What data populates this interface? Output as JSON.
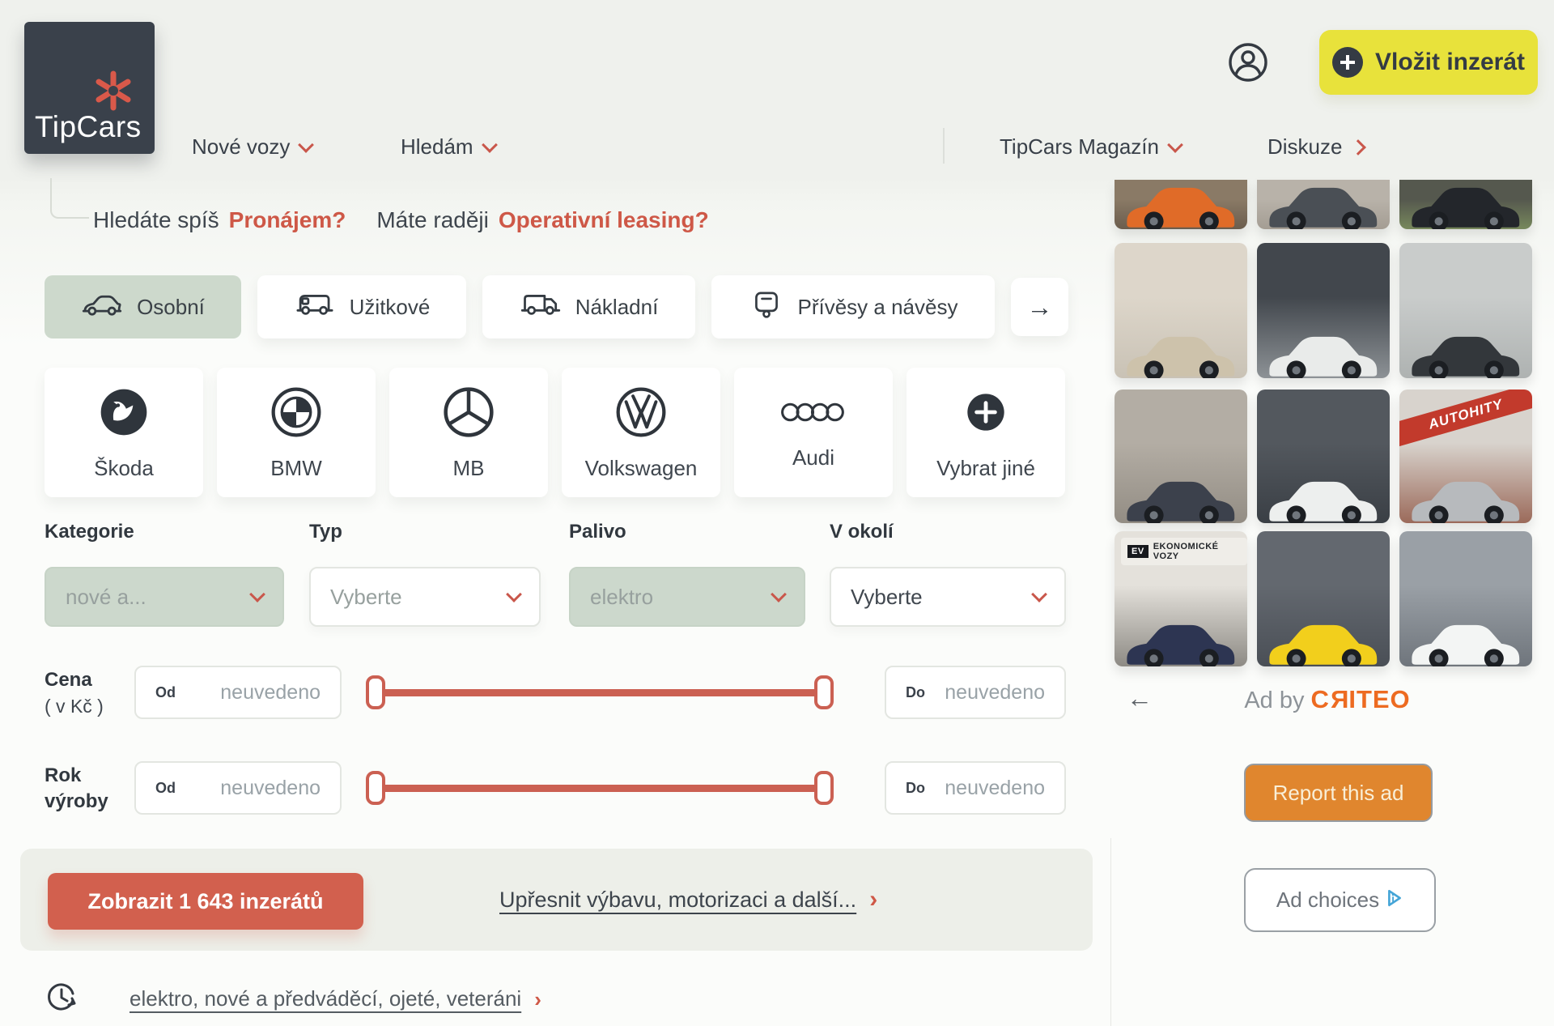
{
  "header": {
    "logo": {
      "text": "TipCars",
      "mark_icon": "asterisk-icon",
      "mark_color": "#d9594a"
    },
    "nav_left": [
      {
        "label": "Nové vozy",
        "chevron": "down"
      },
      {
        "label": "Hledám",
        "chevron": "down"
      }
    ],
    "nav_right": [
      {
        "label": "TipCars Magazín",
        "chevron": "down"
      },
      {
        "label": "Diskuze",
        "chevron": "right"
      }
    ],
    "account_icon": "user-icon",
    "post_button": {
      "label": "Vložit inzerát",
      "icon": "plus-icon"
    }
  },
  "promo": {
    "text1": "Hledáte spíš",
    "link1": "Pronájem?",
    "text2": "Máte raději",
    "link2": "Operativní leasing?"
  },
  "vehicle_types": {
    "items": [
      {
        "label": "Osobní",
        "icon": "car-icon",
        "selected": true
      },
      {
        "label": "Užitkové",
        "icon": "van-icon",
        "selected": false
      },
      {
        "label": "Nákladní",
        "icon": "truck-icon",
        "selected": false
      },
      {
        "label": "Přívěsy a návěsy",
        "icon": "trailer-icon",
        "selected": false
      }
    ],
    "more_arrow": "→"
  },
  "brands": {
    "items": [
      {
        "label": "Škoda",
        "icon": "skoda-logo"
      },
      {
        "label": "BMW",
        "icon": "bmw-logo"
      },
      {
        "label": "MB",
        "icon": "mercedes-logo"
      },
      {
        "label": "Volkswagen",
        "icon": "volkswagen-logo"
      },
      {
        "label": "Audi",
        "icon": "audi-logo"
      },
      {
        "label": "Vybrat jiné",
        "icon": "plus-circle-icon"
      }
    ]
  },
  "filters": {
    "items": [
      {
        "label": "Kategorie",
        "value": "nové a...",
        "filled": true,
        "muted": true
      },
      {
        "label": "Typ",
        "value": "Vyberte",
        "filled": false,
        "muted": true
      },
      {
        "label": "Palivo",
        "value": "elektro",
        "filled": true,
        "muted": true
      },
      {
        "label": "V okolí",
        "value": "Vyberte",
        "filled": false,
        "muted": false
      }
    ]
  },
  "ranges": {
    "items": [
      {
        "line1": "Cena",
        "line2": "( v Kč )",
        "line2_bold": false,
        "from_label": "Od",
        "from_value": "neuvedeno",
        "to_label": "Do",
        "to_value": "neuvedeno"
      },
      {
        "line1": "Rok",
        "line2": "výroby",
        "line2_bold": true,
        "from_label": "Od",
        "from_value": "neuvedeno",
        "to_label": "Do",
        "to_value": "neuvedeno"
      }
    ]
  },
  "results": {
    "submit_label": "Zobrazit 1 643 inzerátů",
    "refine_label": "Upřesnit výbavu, motorizaci a další...",
    "chevron": "›"
  },
  "history": {
    "icon": "history-icon",
    "link": "elektro, nové a předváděcí, ojeté, veteráni",
    "chevron": "›"
  },
  "ad": {
    "back_arrow": "←",
    "label": "Ad by",
    "brand": "CRITEO",
    "report_button": "Report this ad",
    "choices_button": "Ad choices",
    "choices_icon": "adchoices-icon",
    "tiles": [
      {
        "name": "orange-sports-car",
        "env_top": "#8a7a66",
        "env_bottom": "#6b5d4d",
        "body": "#e06b28"
      },
      {
        "name": "gray-suv-front",
        "env_top": "#b8b2a9",
        "env_bottom": "#a49d93",
        "body": "#4a4f55"
      },
      {
        "name": "white-roof-suv-grass",
        "env_top": "#55584e",
        "env_bottom": "#77885c",
        "body": "#23262b"
      },
      {
        "name": "volvo-xc90-studio",
        "env_top": "#ddd6ca",
        "env_bottom": "#c9c2b5",
        "body": "#cdc2ab"
      },
      {
        "name": "ford-bronco-dealership",
        "env_top": "#42474d",
        "env_bottom": "#8d9296",
        "body": "#e9ebea"
      },
      {
        "name": "defender-matte-black",
        "env_top": "#c9cccb",
        "env_bottom": "#aeb2b1",
        "body": "#33373b"
      },
      {
        "name": "rolls-royce-ghost",
        "env_top": "#b3ada4",
        "env_bottom": "#938d84",
        "body": "#3c414c"
      },
      {
        "name": "ford-gt-showroom",
        "env_top": "#53585e",
        "env_bottom": "#3a3f45",
        "body": "#edefee"
      },
      {
        "name": "skoda-kodiaq-autohity",
        "env_top": "#d8d3cd",
        "env_bottom": "#9b6a5a",
        "body": "#b7babd",
        "badge": "AUTOHITY",
        "badge_bg": "#c23a2c",
        "badge_fg": "#ffffff"
      },
      {
        "name": "maserati-levante-ev",
        "env_top": "#e4e1db",
        "env_bottom": "#8d8a84",
        "body": "#2d3552",
        "badge": "EKONOMICKÉ VOZY",
        "badge_tag": "EV",
        "badge_bg": "#efede8",
        "badge_fg": "#23262a"
      },
      {
        "name": "lamborghini-urus-yellow",
        "env_top": "#63686f",
        "env_bottom": "#4a4f56",
        "body": "#f2cf1c"
      },
      {
        "name": "bmw-3gt-white",
        "env_top": "#9aa0a6",
        "env_bottom": "#6f757c",
        "body": "#f3f5f4"
      }
    ]
  },
  "colors": {
    "accent_red": "#cd5a49",
    "sage_fill": "#ccd8cc",
    "header_bg": "#eff1ed",
    "logo_bg": "#3a414b",
    "yellow": "#e8e23b",
    "dark_text": "#3a414a",
    "muted_text": "#99a2a7",
    "criteo_orange": "#ed6b21",
    "report_orange": "#e0862e",
    "adchoices_blue": "#45a5d7"
  }
}
